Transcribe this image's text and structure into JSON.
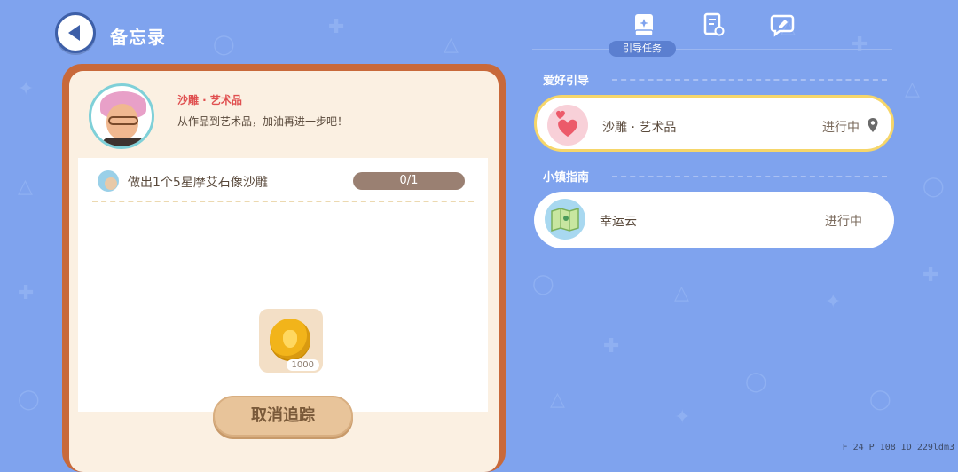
{
  "header": {
    "title": "备忘录"
  },
  "task_card": {
    "name": "沙雕 · 艺术品",
    "description": "从作品到艺术品，加油再进一步吧！",
    "objective": "做出1个5星摩艾石像沙雕",
    "progress_text": "0/1",
    "reward_count": "1000",
    "cancel_label": "取消追踪"
  },
  "tabs": {
    "active_label": "引导任务",
    "icons": [
      "book-icon",
      "document-icon",
      "chat-pencil-icon"
    ]
  },
  "sections": [
    {
      "title": "爱好引导",
      "items": [
        {
          "name": "沙雕 · 艺术品",
          "status": "进行中",
          "selected": true
        }
      ]
    },
    {
      "title": "小镇指南",
      "items": [
        {
          "name": "幸运云",
          "status": "进行中",
          "selected": false
        }
      ]
    }
  ],
  "footer": {
    "stats": "F 24   P 108   ID 229ldm3"
  },
  "colors": {
    "background": "#7fa3ee",
    "card_border": "#c8693a",
    "accent_red": "#e05050",
    "selected_border": "#f6d66a"
  }
}
